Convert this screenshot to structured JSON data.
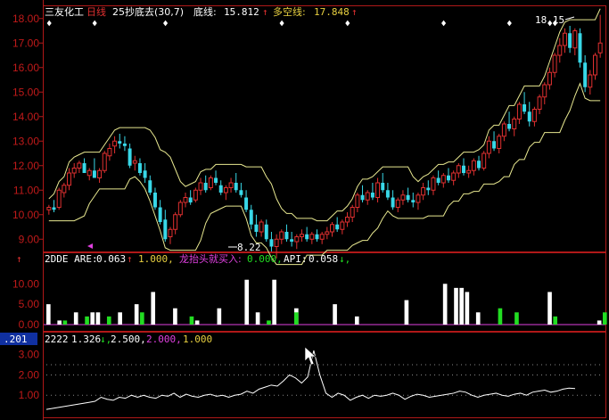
{
  "colors": {
    "background": "#000000",
    "frame": "#b01818",
    "axis_text": "#c01a1a",
    "candle_up": "#e03030",
    "candle_down": "#38d8e8",
    "band": "#e8e890",
    "white": "#ffffff",
    "green": "#22dd22",
    "magenta": "#e040e0",
    "yellow": "#e8d040",
    "indicator_line": "#ffffff"
  },
  "main_panel": {
    "name": "三友化工",
    "period_label": "日线",
    "indicator": "25抄底去(30,7)",
    "bottom_line_label": "底线:",
    "bottom_line_value": "15.812",
    "long_short_label": "多空线:",
    "long_short_value": "17.848",
    "up_arrow": "↑",
    "high_mark": "18.15",
    "low_mark": "8.22",
    "y_ticks": [
      "18.00",
      "17.00",
      "16.00",
      "15.00",
      "14.00",
      "13.00",
      "12.00",
      "11.00",
      "10.00",
      "9.00"
    ]
  },
  "dde_panel": {
    "label": "2DDE ARE:",
    "are_value": "0.063",
    "are_arrow": "↑",
    "value2": "1.000,",
    "dragon_label": "龙抬头就买入:",
    "dragon_value": "0.000,",
    "api_label": "API:",
    "api_value": "0.058",
    "api_arrow": "↓,",
    "y_ticks": [
      "10.00",
      "5.00",
      "0.00"
    ]
  },
  "ind_panel": {
    "label": "2222",
    "value1": "1.326",
    "arrow1": "↓,",
    "value2": "2.500,",
    "value3": "2.000,",
    "value4": "1.000",
    "cursor_readout": ".201",
    "y_ticks": [
      "3.00",
      "2.00",
      "1.00"
    ]
  },
  "chart_data": [
    {
      "type": "candlestick",
      "series_name": "三友化工",
      "ylim": [
        8.5,
        18.5
      ],
      "candles": [
        [
          10.2,
          10.4,
          10.0,
          10.3
        ],
        [
          10.3,
          10.6,
          10.1,
          10.2
        ],
        [
          10.3,
          11.1,
          10.2,
          11.0
        ],
        [
          10.9,
          11.3,
          10.7,
          11.2
        ],
        [
          11.2,
          11.9,
          11.0,
          11.7
        ],
        [
          11.7,
          12.1,
          11.5,
          11.9
        ],
        [
          11.9,
          12.2,
          11.7,
          12.1
        ],
        [
          12.1,
          12.3,
          11.8,
          11.7
        ],
        [
          11.6,
          11.9,
          11.4,
          11.8
        ],
        [
          11.8,
          12.3,
          11.6,
          11.5
        ],
        [
          11.5,
          11.9,
          11.3,
          11.8
        ],
        [
          11.8,
          12.6,
          11.7,
          12.5
        ],
        [
          12.4,
          12.9,
          12.2,
          12.7
        ],
        [
          12.8,
          13.2,
          12.5,
          13.0
        ],
        [
          13.0,
          13.3,
          12.7,
          12.9
        ],
        [
          12.9,
          13.2,
          12.6,
          12.8
        ],
        [
          12.7,
          12.9,
          11.9,
          12.0
        ],
        [
          12.1,
          12.4,
          11.8,
          12.2
        ],
        [
          12.1,
          12.3,
          11.6,
          11.7
        ],
        [
          11.8,
          12.1,
          11.3,
          11.5
        ],
        [
          11.4,
          11.6,
          10.8,
          10.9
        ],
        [
          10.9,
          11.1,
          10.2,
          10.3
        ],
        [
          10.3,
          10.6,
          9.6,
          9.7
        ],
        [
          9.8,
          10.2,
          8.9,
          9.0
        ],
        [
          9.1,
          9.5,
          8.8,
          9.4
        ],
        [
          9.4,
          10.1,
          9.2,
          10.0
        ],
        [
          10.0,
          10.6,
          9.9,
          10.5
        ],
        [
          10.5,
          10.9,
          10.3,
          10.7
        ],
        [
          10.7,
          11.0,
          10.4,
          10.5
        ],
        [
          10.6,
          11.1,
          10.5,
          11.0
        ],
        [
          11.0,
          11.5,
          10.8,
          11.3
        ],
        [
          11.3,
          11.6,
          10.9,
          11.0
        ],
        [
          11.1,
          11.6,
          11.0,
          11.5
        ],
        [
          11.5,
          11.8,
          11.2,
          11.3
        ],
        [
          11.2,
          11.4,
          10.8,
          10.9
        ],
        [
          10.9,
          11.2,
          10.6,
          11.1
        ],
        [
          11.1,
          11.5,
          10.9,
          11.3
        ],
        [
          11.3,
          11.7,
          10.9,
          11.0
        ],
        [
          11.0,
          11.3,
          10.7,
          10.8
        ],
        [
          10.7,
          11.0,
          10.1,
          10.2
        ],
        [
          10.2,
          10.4,
          9.4,
          9.6
        ],
        [
          9.6,
          10.0,
          9.1,
          9.3
        ],
        [
          9.3,
          9.8,
          9.1,
          9.7
        ],
        [
          9.6,
          9.8,
          8.9,
          9.0
        ],
        [
          9.0,
          9.3,
          8.5,
          8.7
        ],
        [
          8.7,
          9.2,
          8.22,
          9.0
        ],
        [
          9.0,
          9.4,
          8.8,
          9.3
        ],
        [
          9.3,
          9.6,
          8.9,
          9.0
        ],
        [
          9.0,
          9.3,
          8.7,
          8.9
        ],
        [
          8.9,
          9.2,
          8.6,
          9.1
        ],
        [
          9.1,
          9.4,
          8.9,
          9.2
        ],
        [
          9.2,
          9.5,
          8.9,
          9.0
        ],
        [
          9.0,
          9.3,
          8.8,
          9.2
        ],
        [
          9.2,
          9.4,
          8.9,
          9.0
        ],
        [
          9.0,
          9.3,
          8.8,
          9.2
        ],
        [
          9.2,
          9.5,
          9.0,
          9.3
        ],
        [
          9.3,
          9.7,
          9.1,
          9.6
        ],
        [
          9.6,
          9.9,
          9.3,
          9.4
        ],
        [
          9.4,
          9.8,
          9.2,
          9.7
        ],
        [
          9.7,
          10.1,
          9.5,
          9.9
        ],
        [
          9.9,
          10.4,
          9.7,
          10.3
        ],
        [
          10.3,
          10.9,
          10.1,
          10.8
        ],
        [
          10.8,
          11.2,
          10.5,
          10.6
        ],
        [
          10.6,
          11.0,
          10.4,
          10.9
        ],
        [
          10.9,
          11.3,
          10.6,
          10.7
        ],
        [
          10.7,
          11.5,
          10.5,
          11.3
        ],
        [
          11.3,
          11.7,
          10.9,
          11.0
        ],
        [
          11.0,
          11.3,
          10.6,
          10.7
        ],
        [
          10.7,
          11.0,
          10.2,
          10.3
        ],
        [
          10.3,
          10.7,
          10.1,
          10.6
        ],
        [
          10.6,
          11.0,
          10.4,
          10.8
        ],
        [
          10.8,
          11.1,
          10.5,
          10.6
        ],
        [
          10.6,
          10.9,
          10.3,
          10.5
        ],
        [
          10.5,
          10.9,
          10.2,
          10.8
        ],
        [
          10.8,
          11.3,
          10.6,
          11.1
        ],
        [
          11.1,
          11.4,
          10.8,
          11.0
        ],
        [
          11.0,
          11.6,
          10.8,
          11.5
        ],
        [
          11.5,
          11.8,
          11.2,
          11.3
        ],
        [
          11.3,
          11.7,
          11.1,
          11.6
        ],
        [
          11.6,
          11.9,
          11.3,
          11.4
        ],
        [
          11.4,
          11.8,
          11.2,
          11.7
        ],
        [
          11.7,
          12.1,
          11.5,
          12.0
        ],
        [
          12.0,
          12.3,
          11.6,
          11.7
        ],
        [
          11.7,
          12.0,
          11.5,
          11.8
        ],
        [
          11.8,
          12.3,
          11.6,
          12.2
        ],
        [
          12.2,
          12.4,
          11.8,
          11.9
        ],
        [
          11.9,
          12.6,
          11.8,
          12.5
        ],
        [
          12.5,
          13.2,
          12.3,
          13.0
        ],
        [
          13.0,
          13.4,
          12.6,
          12.7
        ],
        [
          12.7,
          13.3,
          12.5,
          13.2
        ],
        [
          13.2,
          13.8,
          13.0,
          13.7
        ],
        [
          13.7,
          14.2,
          13.4,
          13.5
        ],
        [
          13.5,
          14.0,
          13.2,
          13.9
        ],
        [
          13.9,
          14.6,
          13.7,
          14.5
        ],
        [
          14.5,
          15.0,
          14.1,
          14.2
        ],
        [
          14.2,
          14.6,
          13.6,
          13.8
        ],
        [
          13.8,
          14.4,
          13.6,
          14.3
        ],
        [
          14.3,
          14.9,
          14.1,
          14.8
        ],
        [
          14.8,
          15.4,
          14.5,
          15.3
        ],
        [
          15.3,
          16.0,
          15.1,
          15.8
        ],
        [
          15.8,
          16.6,
          15.6,
          16.5
        ],
        [
          16.5,
          17.2,
          16.2,
          16.9
        ],
        [
          16.9,
          17.6,
          16.6,
          17.4
        ],
        [
          17.4,
          17.7,
          16.6,
          16.8
        ],
        [
          16.8,
          17.6,
          16.5,
          17.5
        ],
        [
          17.4,
          17.6,
          16.0,
          16.2
        ],
        [
          16.2,
          16.5,
          15.0,
          15.2
        ],
        [
          15.2,
          15.9,
          14.9,
          15.7
        ],
        [
          15.7,
          16.6,
          15.5,
          16.5
        ],
        [
          16.6,
          18.15,
          16.4,
          17.0
        ]
      ]
    },
    {
      "type": "bar",
      "series_name": "2DDE",
      "ylim": [
        0,
        14
      ],
      "white_values": [
        5,
        0,
        1,
        0,
        0,
        3,
        0,
        0,
        3,
        3,
        0,
        0,
        0,
        3,
        0,
        0,
        5,
        0,
        0,
        8,
        0,
        0,
        0,
        4,
        0,
        0,
        0,
        1,
        0,
        0,
        0,
        4,
        0,
        0,
        0,
        0,
        11,
        0,
        3,
        0,
        0,
        11,
        0,
        0,
        0,
        4,
        0,
        0,
        0,
        0,
        0,
        0,
        5,
        0,
        0,
        0,
        2,
        0,
        0,
        0,
        0,
        0,
        0,
        0,
        0,
        6,
        0,
        0,
        0,
        0,
        0,
        0,
        10,
        0,
        9,
        9,
        8,
        0,
        3,
        0,
        0,
        0,
        0,
        0,
        0,
        0,
        0,
        0,
        0,
        0,
        0,
        8,
        0,
        0,
        0,
        0,
        0,
        0,
        0,
        0,
        1
      ],
      "green_values": [
        0,
        0,
        0,
        1,
        0,
        0,
        0,
        2,
        0,
        0,
        0,
        2,
        0,
        0,
        0,
        0,
        0,
        3,
        0,
        0,
        0,
        0,
        0,
        0,
        0,
        0,
        2,
        0,
        0,
        0,
        0,
        0,
        0,
        0,
        0,
        0,
        0,
        0,
        0,
        0,
        1,
        0,
        0,
        0,
        0,
        3,
        0,
        0,
        0,
        0,
        0,
        0,
        0,
        0,
        0,
        0,
        0,
        0,
        0,
        0,
        0,
        0,
        0,
        0,
        0,
        0,
        0,
        0,
        0,
        0,
        0,
        0,
        0,
        0,
        0,
        0,
        0,
        0,
        0,
        0,
        0,
        0,
        4,
        0,
        0,
        3,
        0,
        0,
        0,
        0,
        0,
        0,
        2,
        0,
        0,
        0,
        0,
        0,
        0,
        0,
        0,
        3
      ]
    },
    {
      "type": "line",
      "series_name": "2222",
      "ylim": [
        0.0,
        3.6
      ],
      "values": [
        0.3,
        0.35,
        0.4,
        0.45,
        0.5,
        0.55,
        0.6,
        0.65,
        0.7,
        0.9,
        0.8,
        0.75,
        0.9,
        0.85,
        1.0,
        0.9,
        1.0,
        0.9,
        0.85,
        1.0,
        0.95,
        1.1,
        0.9,
        1.05,
        0.95,
        0.9,
        1.0,
        1.05,
        0.95,
        1.0,
        0.9,
        1.0,
        1.05,
        1.2,
        1.1,
        1.3,
        1.4,
        1.5,
        1.45,
        1.7,
        2.0,
        1.85,
        1.6,
        1.9,
        3.2,
        2.0,
        1.1,
        0.9,
        1.1,
        1.0,
        0.75,
        0.9,
        1.0,
        0.85,
        1.0,
        0.95,
        1.0,
        1.1,
        1.0,
        0.8,
        0.95,
        1.05,
        1.0,
        0.9,
        0.95,
        1.0,
        1.05,
        1.1,
        1.2,
        1.15,
        1.0,
        0.9,
        1.0,
        1.05,
        1.1,
        1.0,
        0.95,
        1.05,
        1.1,
        1.0,
        1.15,
        1.2,
        1.25,
        1.15,
        1.2,
        1.3,
        1.35,
        1.326
      ]
    }
  ]
}
